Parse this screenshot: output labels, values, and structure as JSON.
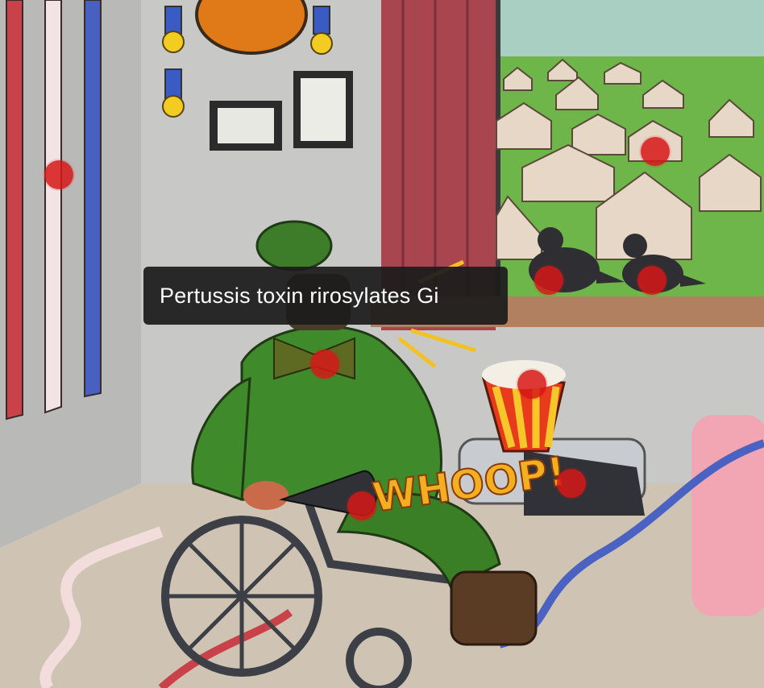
{
  "tooltip": {
    "text": "Pertussis toxin rirosylates Gi"
  },
  "scene": {
    "sound_effect": "WHOOP!"
  },
  "hotspots": [
    {
      "name": "hotspot-wall-stripes"
    },
    {
      "name": "hotspot-village-hut"
    },
    {
      "name": "hotspot-left-crow"
    },
    {
      "name": "hotspot-right-crow"
    },
    {
      "name": "hotspot-bow-tie"
    },
    {
      "name": "hotspot-popcorn"
    },
    {
      "name": "hotspot-leg-cast"
    },
    {
      "name": "hotspot-horn"
    }
  ],
  "colors": {
    "hotspot": "#d61818",
    "tooltip_bg": "#1c1c1c",
    "uniform": "#3f8a2a",
    "wall": "#c9c9c6",
    "curtain": "#a8454f",
    "grass": "#6fb64a"
  }
}
